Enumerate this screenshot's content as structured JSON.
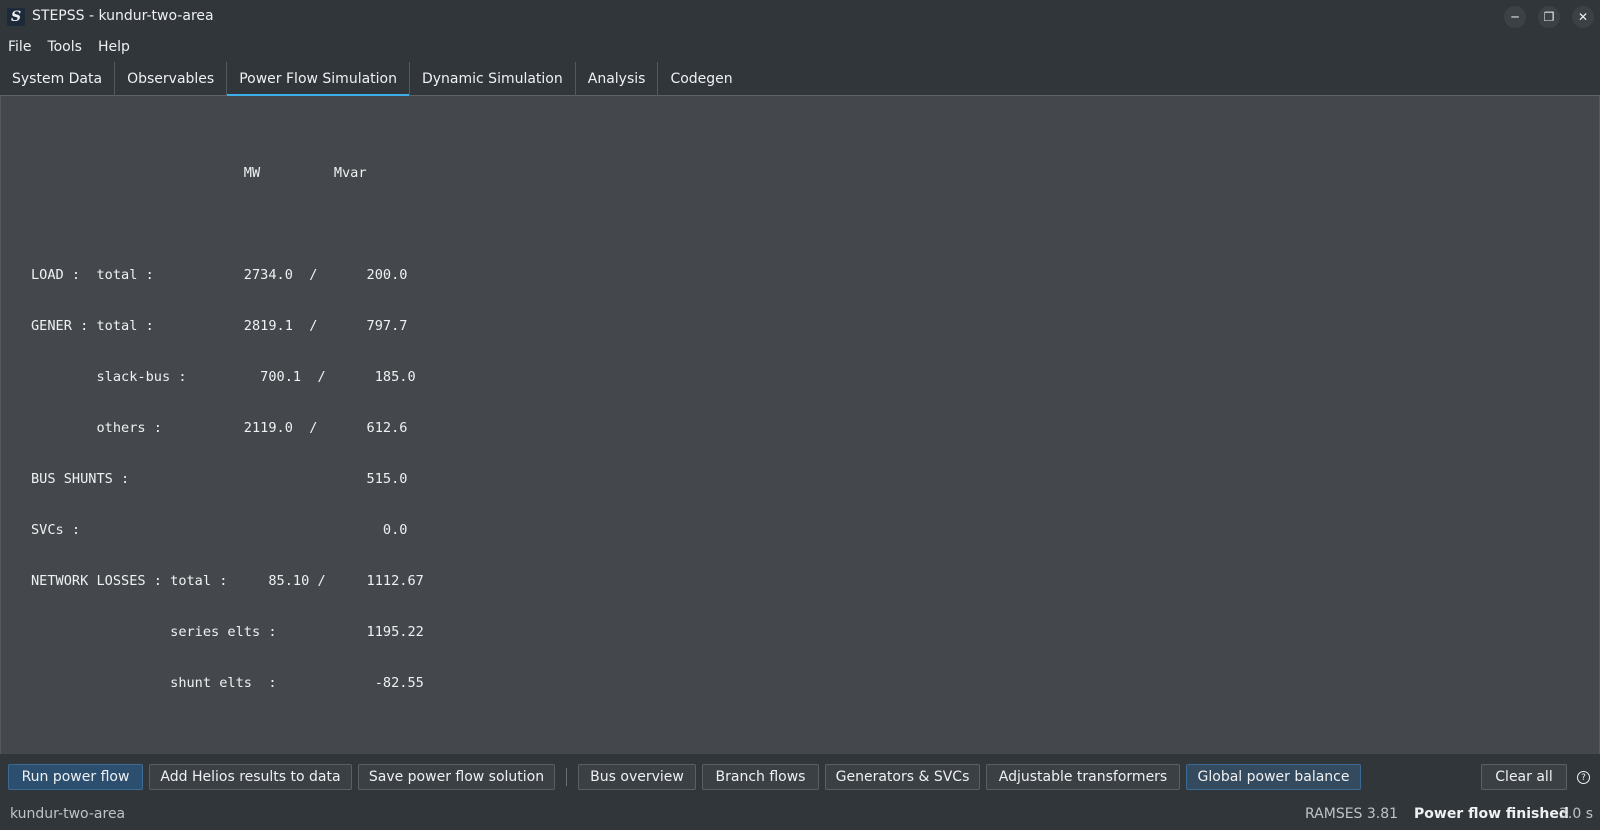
{
  "window": {
    "title": "STEPSS - kundur-two-area",
    "logo_letter": "S",
    "controls": {
      "minimize": "─",
      "restore": "❐",
      "close": "✕"
    }
  },
  "menu": [
    "File",
    "Tools",
    "Help"
  ],
  "tabs": [
    {
      "label": "System Data",
      "active": false
    },
    {
      "label": "Observables",
      "active": false
    },
    {
      "label": "Power Flow Simulation",
      "active": true
    },
    {
      "label": "Dynamic Simulation",
      "active": false
    },
    {
      "label": "Analysis",
      "active": false
    },
    {
      "label": "Codegen",
      "active": false
    }
  ],
  "console": {
    "lines": [
      "                          MW         Mvar",
      "",
      "LOAD :  total :           2734.0  /      200.0",
      "GENER : total :           2819.1  /      797.7",
      "        slack-bus :         700.1  /      185.0",
      "        others :          2119.0  /      612.6",
      "BUS SHUNTS :                             515.0",
      "SVCs :                                     0.0",
      "NETWORK LOSSES : total :     85.10 /     1112.67",
      "                 series elts :           1195.22",
      "                 shunt elts  :            -82.55"
    ]
  },
  "buttons": {
    "run_power_flow": "Run power flow",
    "add_helios": "Add Helios results to data",
    "save_solution": "Save power flow solution",
    "bus_overview": "Bus overview",
    "branch_flows": "Branch flows",
    "generators_svcs": "Generators & SVCs",
    "adjustable_transformers": "Adjustable transformers",
    "global_power_balance": "Global power balance",
    "clear_all": "Clear all",
    "help": "?"
  },
  "status": {
    "project": "kundur-two-area",
    "version": "RAMSES 3.81",
    "message": "Power flow finished",
    "time": "3.0 s"
  },
  "colors": {
    "accent": "#3daee9",
    "primary_button": "#2c4e6f",
    "background": "#31363b",
    "console_bg": "#44484c"
  }
}
